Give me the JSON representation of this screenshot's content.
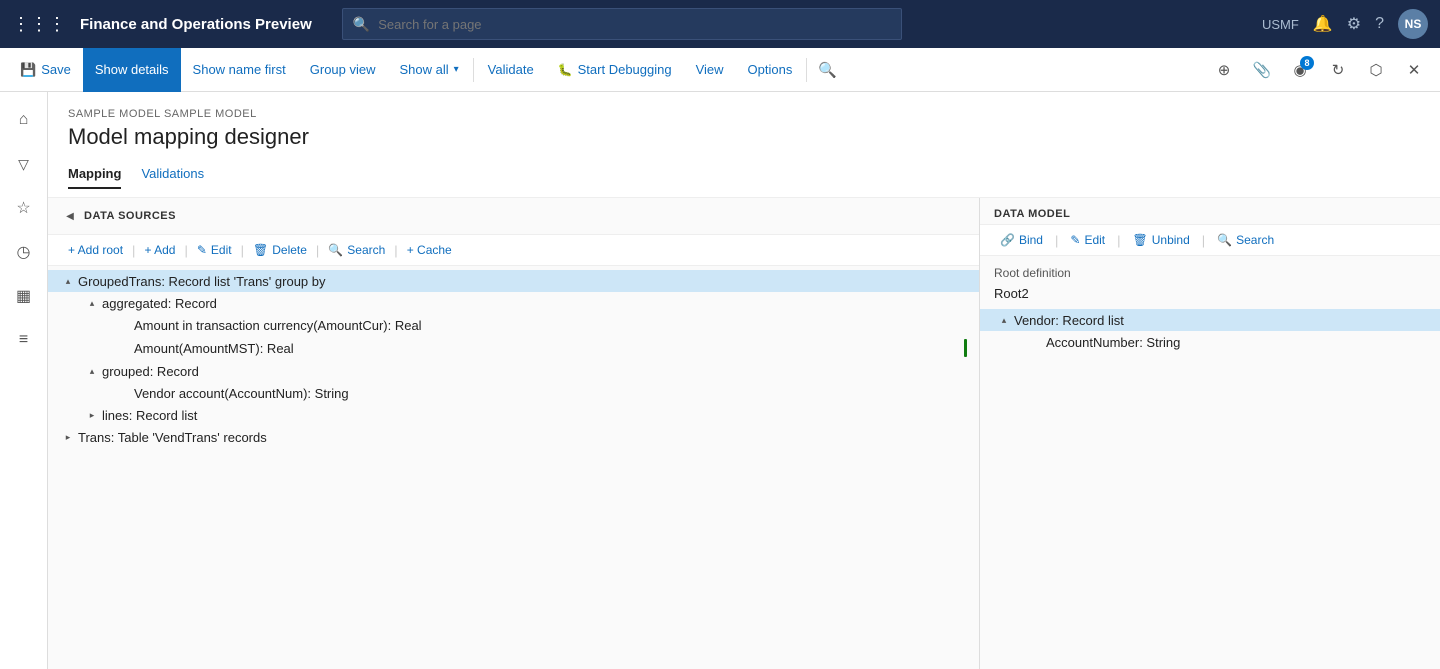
{
  "app": {
    "title": "Finance and Operations Preview",
    "search_placeholder": "Search for a page",
    "user_code": "USMF",
    "avatar": "NS"
  },
  "toolbar": {
    "save_label": "Save",
    "show_details_label": "Show details",
    "show_name_label": "Show name first",
    "group_view_label": "Group view",
    "show_all_label": "Show all",
    "validate_label": "Validate",
    "start_debugging_label": "Start Debugging",
    "view_label": "View",
    "options_label": "Options",
    "badge_count": "8"
  },
  "page": {
    "breadcrumb": "SAMPLE MODEL SAMPLE MODEL",
    "title": "Model mapping designer",
    "tabs": [
      {
        "label": "Mapping",
        "active": true
      },
      {
        "label": "Validations",
        "active": false
      }
    ]
  },
  "data_sources": {
    "panel_title": "DATA SOURCES",
    "toolbar": {
      "add_root": "+ Add root",
      "add": "+ Add",
      "edit": "Edit",
      "delete": "Delete",
      "search": "Search",
      "cache": "+ Cache"
    },
    "tree": [
      {
        "id": "grouped_trans",
        "label": "GroupedTrans: Record list 'Trans' group by",
        "level": 0,
        "expanded": true,
        "selected": true,
        "children": [
          {
            "id": "aggregated",
            "label": "aggregated: Record",
            "level": 1,
            "expanded": true,
            "children": [
              {
                "id": "amount_cur",
                "label": "Amount in transaction currency(AmountCur): Real",
                "level": 2,
                "expanded": false,
                "children": []
              },
              {
                "id": "amount_mst",
                "label": "Amount(AmountMST): Real",
                "level": 2,
                "expanded": false,
                "children": [],
                "has_indicator": true
              }
            ]
          },
          {
            "id": "grouped",
            "label": "grouped: Record",
            "level": 1,
            "expanded": true,
            "children": [
              {
                "id": "vendor_account",
                "label": "Vendor account(AccountNum): String",
                "level": 2,
                "expanded": false,
                "children": []
              }
            ]
          },
          {
            "id": "lines",
            "label": "lines: Record list",
            "level": 1,
            "expanded": false,
            "children": []
          }
        ]
      },
      {
        "id": "trans",
        "label": "Trans: Table 'VendTrans' records",
        "level": 0,
        "expanded": false,
        "children": []
      }
    ]
  },
  "data_model": {
    "panel_title": "DATA MODEL",
    "toolbar": {
      "bind": "Bind",
      "edit": "Edit",
      "unbind": "Unbind",
      "search": "Search"
    },
    "root_definition_label": "Root definition",
    "root_definition_value": "Root2",
    "tree": [
      {
        "id": "vendor",
        "label": "Vendor: Record list",
        "level": 0,
        "expanded": true,
        "selected": true,
        "children": [
          {
            "id": "account_number",
            "label": "AccountNumber: String",
            "level": 1,
            "expanded": false,
            "children": []
          }
        ]
      }
    ]
  },
  "sidebar": {
    "icons": [
      {
        "name": "home",
        "symbol": "⌂",
        "active": false
      },
      {
        "name": "favorites",
        "symbol": "☆",
        "active": false
      },
      {
        "name": "recent",
        "symbol": "◷",
        "active": false
      },
      {
        "name": "workspace",
        "symbol": "▦",
        "active": false
      },
      {
        "name": "modules",
        "symbol": "≡",
        "active": false
      }
    ]
  }
}
